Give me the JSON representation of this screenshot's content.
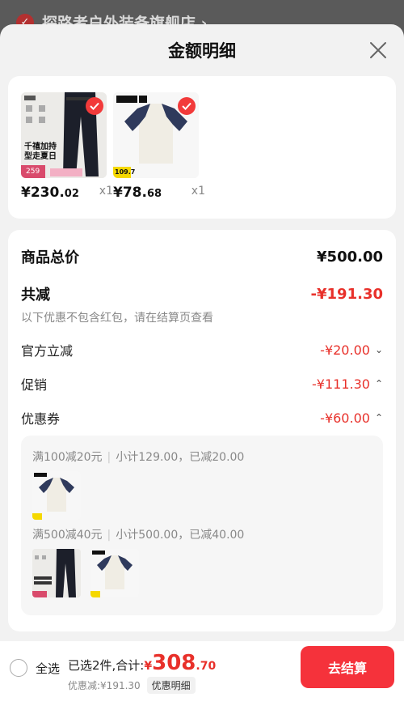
{
  "background": {
    "store_name": "探路者户外装备旗舰店 ›"
  },
  "sheet": {
    "title": "金额明细",
    "close_icon": "close-icon"
  },
  "products": [
    {
      "name": "pants",
      "price_int": "¥230.",
      "price_dec": "02",
      "qty": "x1",
      "thumb_text_1": "千禧加持",
      "thumb_text_2": "型走夏日",
      "thumb_badge": "259"
    },
    {
      "name": "tshirt",
      "price_int": "¥78.",
      "price_dec": "68",
      "qty": "x1",
      "thumb_badge": "109.7"
    }
  ],
  "details": {
    "total_label": "商品总价",
    "total_value": "¥500.00",
    "discount_label": "共减",
    "discount_value": "-¥191.30",
    "discount_note": "以下优惠不包含红包，请在结算页查看",
    "official_label": "官方立减",
    "official_value": "-¥20.00",
    "promo_label": "促销",
    "promo_value": "-¥111.30",
    "coupon_label": "优惠券",
    "coupon_value": "-¥60.00"
  },
  "coupons": [
    {
      "rule": "满100减20元",
      "subtotal": "小计129.00，已减20.00"
    },
    {
      "rule": "满500减40元",
      "subtotal": "小计500.00，已减40.00"
    }
  ],
  "bottom": {
    "select_all": "全选",
    "summary_text": "已选2件,合计:",
    "currency": "¥",
    "total_int": "308",
    "total_dec": ".70",
    "discount_text": "优惠减:¥191.30",
    "detail_chip": "优惠明细",
    "checkout": "去结算"
  },
  "colors": {
    "accent_red": "#e8302a",
    "button_red": "#f5323b"
  }
}
